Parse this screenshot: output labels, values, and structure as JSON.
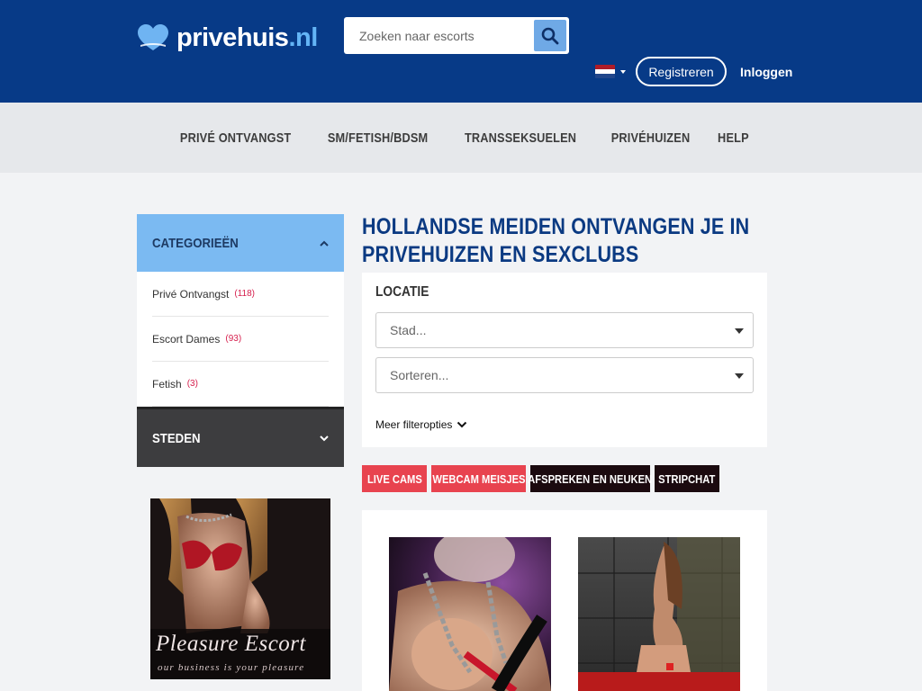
{
  "header": {
    "logo": {
      "name": "privehuis",
      "tld": ".nl"
    },
    "search": {
      "placeholder": "Zoeken naar escorts"
    },
    "register_label": "Registreren",
    "login_label": "Inloggen"
  },
  "nav": {
    "items": [
      "PRIVÉ ONTVANGST",
      "SM/FETISH/BDSM",
      "TRANSSEKSUELEN",
      "PRIVÉHUIZEN",
      "HELP"
    ]
  },
  "sidebar": {
    "categories_title": "CATEGORIEËN",
    "categories": [
      {
        "label": "Privé Ontvangst",
        "count": "(118)"
      },
      {
        "label": "Escort Dames",
        "count": "(93)"
      },
      {
        "label": "Fetish",
        "count": "(3)"
      }
    ],
    "steden_title": "STEDEN"
  },
  "ad": {
    "brand": "Pleasure Escort",
    "tagline": "our business is your pleasure"
  },
  "main": {
    "title": "HOLLANDSE MEIDEN ONTVANGEN JE IN PRIVEHUIZEN EN SEXCLUBS",
    "filter": {
      "label": "LOCATIE",
      "city_placeholder": "Stad...",
      "sort_placeholder": "Sorteren...",
      "more_label": "Meer filteropties"
    },
    "promos": [
      {
        "label": "LIVE CAMS",
        "color": "#e8434f"
      },
      {
        "label": "WEBCAM MEISJES",
        "color": "#e8434f"
      },
      {
        "label": "AFSPREKEN EN NEUKEN",
        "color": "#1b0a0f"
      },
      {
        "label": "STRIPCHAT",
        "color": "#1b0a0f"
      }
    ]
  },
  "colors": {
    "header_bg": "#073a87",
    "nav_bg": "#e6e8eb",
    "categories_bg": "#7bbaf2",
    "steden_bg": "#3d3d3f",
    "accent_red": "#e8434f",
    "count_red": "#d6204e"
  }
}
